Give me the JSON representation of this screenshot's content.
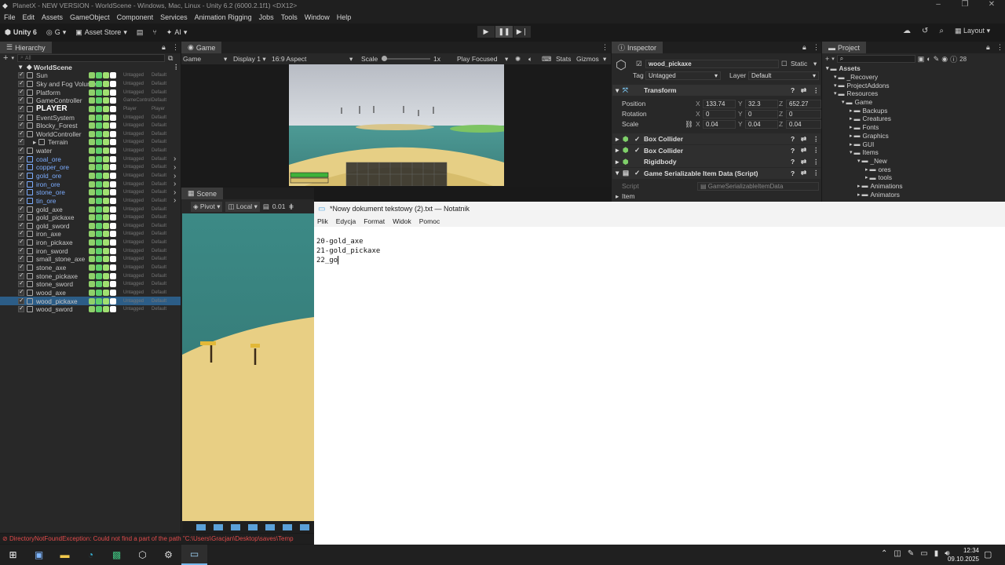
{
  "window": {
    "title": "PlanetX - NEW VERSION - WorldScene - Windows, Mac, Linux - Unity 6.2 (6000.2.1f1) <DX12>"
  },
  "menu": [
    "File",
    "Edit",
    "Assets",
    "GameObject",
    "Component",
    "Services",
    "Animation Rigging",
    "Jobs",
    "Tools",
    "Window",
    "Help"
  ],
  "toolbar": {
    "account": "Unity 6",
    "account_g": "G",
    "asset_store": "Asset Store",
    "ai": "AI",
    "layout": "Layout"
  },
  "hierarchy": {
    "tab": "Hierarchy",
    "search_placeholder": "All",
    "scene": "WorldScene",
    "items": [
      {
        "label": "Sun",
        "tag": "Untagged",
        "layer": "Default",
        "style": ""
      },
      {
        "label": "Sky and Fog Volume",
        "tag": "Untagged",
        "layer": "Default",
        "style": ""
      },
      {
        "label": "Platform",
        "tag": "Untagged",
        "layer": "Default",
        "style": ""
      },
      {
        "label": "GameController",
        "tag": "GameControl",
        "layer": "Default",
        "style": ""
      },
      {
        "label": "PLAYER",
        "tag": "Player",
        "layer": "Player",
        "style": "bold"
      },
      {
        "label": "EventSystem",
        "tag": "Untagged",
        "layer": "Default",
        "style": ""
      },
      {
        "label": "Blocky_Forest",
        "tag": "Untagged",
        "layer": "Default",
        "style": ""
      },
      {
        "label": "WorldController",
        "tag": "Untagged",
        "layer": "Default",
        "style": ""
      },
      {
        "label": "Terrain",
        "tag": "Untagged",
        "layer": "Default",
        "style": "child"
      },
      {
        "label": "water",
        "tag": "Untagged",
        "layer": "Default",
        "style": ""
      },
      {
        "label": "coal_ore",
        "tag": "Untagged",
        "layer": "Default",
        "style": "blue"
      },
      {
        "label": "copper_ore",
        "tag": "Untagged",
        "layer": "Default",
        "style": "blue"
      },
      {
        "label": "gold_ore",
        "tag": "Untagged",
        "layer": "Default",
        "style": "blue"
      },
      {
        "label": "iron_ore",
        "tag": "Untagged",
        "layer": "Default",
        "style": "blue"
      },
      {
        "label": "stone_ore",
        "tag": "Untagged",
        "layer": "Default",
        "style": "blue"
      },
      {
        "label": "tin_ore",
        "tag": "Untagged",
        "layer": "Default",
        "style": "blue"
      },
      {
        "label": "gold_axe",
        "tag": "Untagged",
        "layer": "Default",
        "style": ""
      },
      {
        "label": "gold_pickaxe",
        "tag": "Untagged",
        "layer": "Default",
        "style": ""
      },
      {
        "label": "gold_sword",
        "tag": "Untagged",
        "layer": "Default",
        "style": ""
      },
      {
        "label": "iron_axe",
        "tag": "Untagged",
        "layer": "Default",
        "style": ""
      },
      {
        "label": "iron_pickaxe",
        "tag": "Untagged",
        "layer": "Default",
        "style": ""
      },
      {
        "label": "iron_sword",
        "tag": "Untagged",
        "layer": "Default",
        "style": ""
      },
      {
        "label": "small_stone_axe",
        "tag": "Untagged",
        "layer": "Default",
        "style": ""
      },
      {
        "label": "stone_axe",
        "tag": "Untagged",
        "layer": "Default",
        "style": ""
      },
      {
        "label": "stone_pickaxe",
        "tag": "Untagged",
        "layer": "Default",
        "style": ""
      },
      {
        "label": "stone_sword",
        "tag": "Untagged",
        "layer": "Default",
        "style": ""
      },
      {
        "label": "wood_axe",
        "tag": "Untagged",
        "layer": "Default",
        "style": ""
      },
      {
        "label": "wood_pickaxe",
        "tag": "Untagged",
        "layer": "Default",
        "style": "sel"
      },
      {
        "label": "wood_sword",
        "tag": "Untagged",
        "layer": "Default",
        "style": ""
      }
    ]
  },
  "game": {
    "tab": "Game",
    "mode": "Game",
    "display": "Display 1",
    "aspect": "16:9 Aspect",
    "scale_label": "Scale",
    "scale_value": "1x",
    "play_focused": "Play Focused",
    "stats": "Stats",
    "gizmos": "Gizmos"
  },
  "scene": {
    "tab": "Scene",
    "pivot": "Pivot",
    "local": "Local",
    "snap": "0.01"
  },
  "inspector": {
    "tab": "Inspector",
    "object_name": "wood_pickaxe",
    "static": "Static",
    "tag_label": "Tag",
    "tag_value": "Untagged",
    "layer_label": "Layer",
    "layer_value": "Default",
    "transform": "Transform",
    "position_label": "Position",
    "rotation_label": "Rotation",
    "scale_label": "Scale",
    "position": {
      "x": "133.74",
      "y": "32.3",
      "z": "652.27"
    },
    "rotation": {
      "x": "0",
      "y": "0",
      "z": "0"
    },
    "scale": {
      "x": "0.04",
      "y": "0.04",
      "z": "0.04"
    },
    "components": [
      "Box Collider",
      "Box Collider",
      "Rigidbody",
      "Game Serializable Item Data (Script)"
    ],
    "script_label": "Script",
    "script_value": "GameSerializableItemData",
    "item_label": "Item"
  },
  "project": {
    "tab": "Project",
    "tree": [
      {
        "label": "Assets",
        "depth": 0,
        "bold": true
      },
      {
        "label": "_Recovery",
        "depth": 1
      },
      {
        "label": "ProjectAddons",
        "depth": 1
      },
      {
        "label": "Resources",
        "depth": 1
      },
      {
        "label": "Game",
        "depth": 2
      },
      {
        "label": "Backups",
        "depth": 3
      },
      {
        "label": "Creatures",
        "depth": 3
      },
      {
        "label": "Fonts",
        "depth": 3
      },
      {
        "label": "Graphics",
        "depth": 3
      },
      {
        "label": "GUI",
        "depth": 3
      },
      {
        "label": "Items",
        "depth": 3
      },
      {
        "label": "_New",
        "depth": 4
      },
      {
        "label": "ores",
        "depth": 5
      },
      {
        "label": "tools",
        "depth": 5
      },
      {
        "label": "Animations",
        "depth": 4
      },
      {
        "label": "Animators",
        "depth": 4
      }
    ]
  },
  "notepad": {
    "title": "*Nowy dokument tekstowy (2).txt — Notatnik",
    "menu": [
      "Plik",
      "Edycja",
      "Format",
      "Widok",
      "Pomoc"
    ],
    "text": "20-gold_axe\n21-gold_pickaxe\n22_go"
  },
  "console": {
    "error": "DirectoryNotFoundException: Could not find a part of the path \"C:\\Users\\Gracjan\\Desktop\\saves\\Temp"
  },
  "taskbar": {
    "time": "12:34",
    "date": "09.10.2025"
  },
  "colors": {
    "selection": "#2c5d87",
    "prefab_blue": "#7cadff",
    "error_red": "#e24b4b"
  }
}
